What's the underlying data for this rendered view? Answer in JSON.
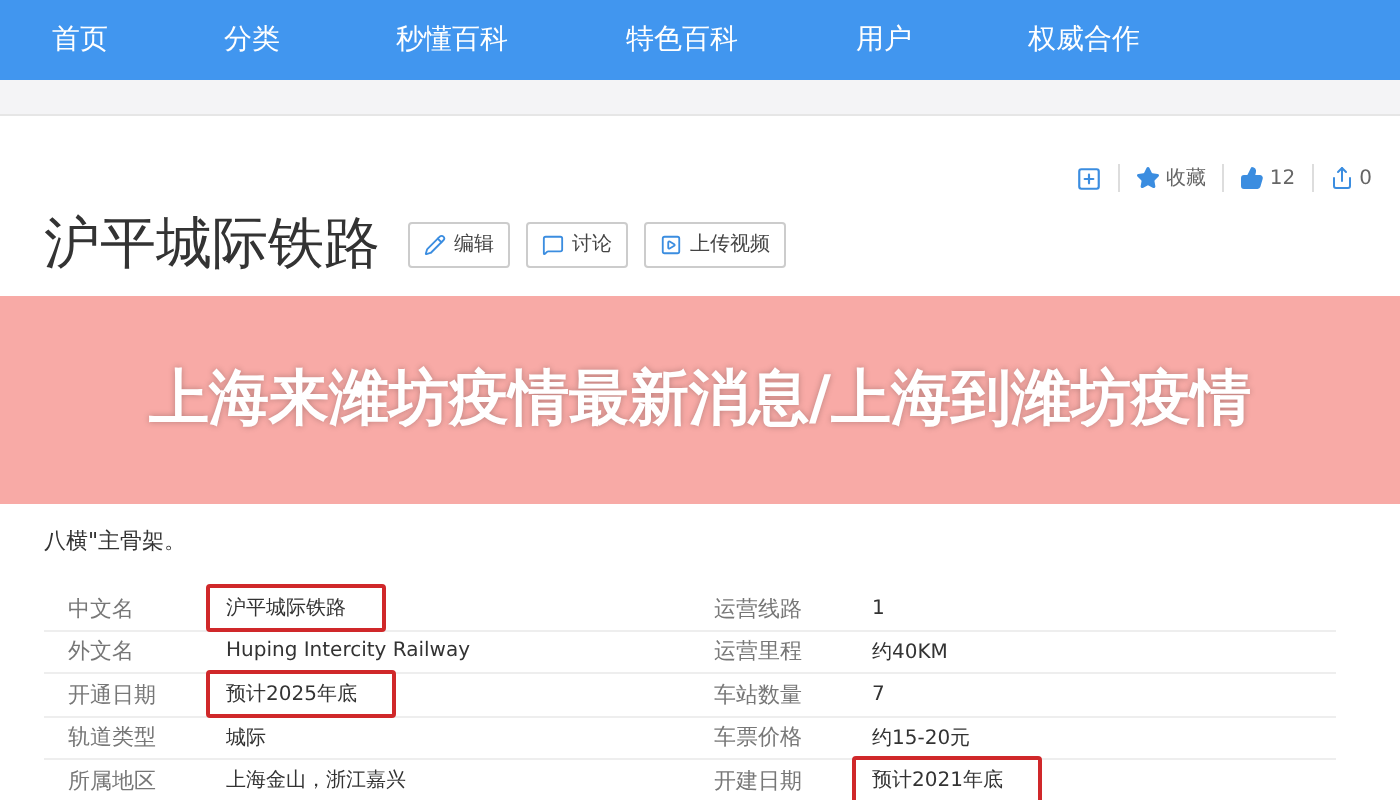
{
  "nav": [
    {
      "label": "首页"
    },
    {
      "label": "分类"
    },
    {
      "label": "秒懂百科"
    },
    {
      "label": "特色百科"
    },
    {
      "label": "用户"
    },
    {
      "label": "权威合作"
    }
  ],
  "actions": {
    "favorite": "收藏",
    "likes": "12",
    "shares": "0"
  },
  "title": "沪平城际铁路",
  "buttons": [
    {
      "kind": "edit",
      "label": "编辑"
    },
    {
      "kind": "discuss",
      "label": "讨论"
    },
    {
      "kind": "video",
      "label": "上传视频"
    }
  ],
  "banner": {
    "headline": "上海来潍坊疫情最新消息/上海到潍坊疫情"
  },
  "paragraph_tail": "八横\"主骨架。",
  "info": [
    {
      "label": "中文名",
      "value": "沪平城际铁路",
      "highlighted": true
    },
    {
      "label": "运营线路",
      "value": "1",
      "highlighted": false
    },
    {
      "label": "外文名",
      "value": "Huping Intercity Railway",
      "highlighted": false
    },
    {
      "label": "运营里程",
      "value": "约40KM",
      "highlighted": false
    },
    {
      "label": "开通日期",
      "value": "预计2025年底",
      "highlighted": true
    },
    {
      "label": "车站数量",
      "value": "7",
      "highlighted": false
    },
    {
      "label": "轨道类型",
      "value": "城际",
      "highlighted": false
    },
    {
      "label": "车票价格",
      "value": "约15-20元",
      "highlighted": false
    },
    {
      "label": "所属地区",
      "value": "上海金山，浙江嘉兴",
      "highlighted": false
    },
    {
      "label": "开建日期",
      "value": "预计2021年底",
      "highlighted": true
    }
  ]
}
